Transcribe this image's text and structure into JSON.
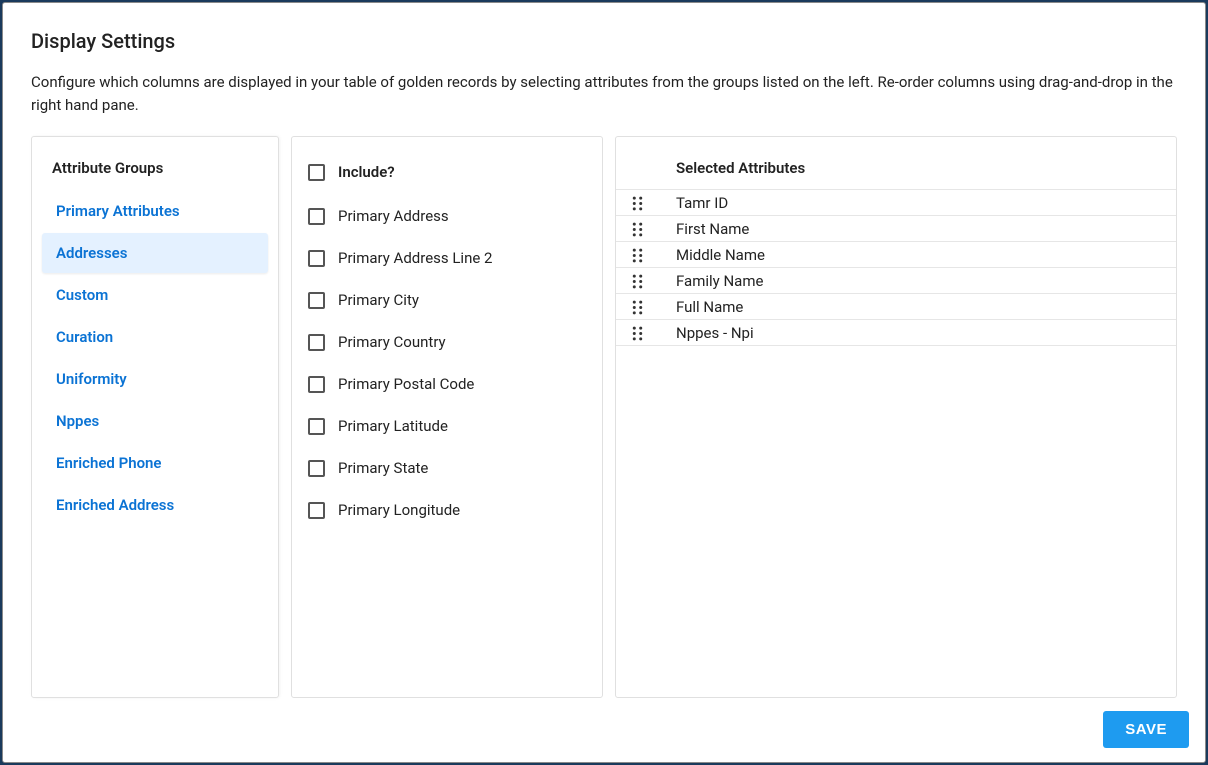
{
  "modal": {
    "title": "Display Settings",
    "description": "Configure which columns are displayed in your table of golden records by selecting attributes from the groups listed on the left. Re-order columns using drag-and-drop in the right hand pane."
  },
  "groups": {
    "title": "Attribute Groups",
    "items": [
      {
        "label": "Primary Attributes",
        "active": false
      },
      {
        "label": "Addresses",
        "active": true
      },
      {
        "label": "Custom",
        "active": false
      },
      {
        "label": "Curation",
        "active": false
      },
      {
        "label": "Uniformity",
        "active": false
      },
      {
        "label": "Nppes",
        "active": false
      },
      {
        "label": "Enriched Phone",
        "active": false
      },
      {
        "label": "Enriched Address",
        "active": false
      }
    ]
  },
  "include": {
    "title": "Include?",
    "items": [
      {
        "label": "Primary Address",
        "checked": false
      },
      {
        "label": "Primary Address Line 2",
        "checked": false
      },
      {
        "label": "Primary City",
        "checked": false
      },
      {
        "label": "Primary Country",
        "checked": false
      },
      {
        "label": "Primary Postal Code",
        "checked": false
      },
      {
        "label": "Primary Latitude",
        "checked": false
      },
      {
        "label": "Primary State",
        "checked": false
      },
      {
        "label": "Primary Longitude",
        "checked": false
      }
    ]
  },
  "selected": {
    "title": "Selected Attributes",
    "items": [
      {
        "label": "Tamr ID"
      },
      {
        "label": "First Name"
      },
      {
        "label": "Middle Name"
      },
      {
        "label": "Family Name"
      },
      {
        "label": "Full Name"
      },
      {
        "label": "Nppes - Npi"
      }
    ]
  },
  "footer": {
    "save_label": "SAVE"
  }
}
